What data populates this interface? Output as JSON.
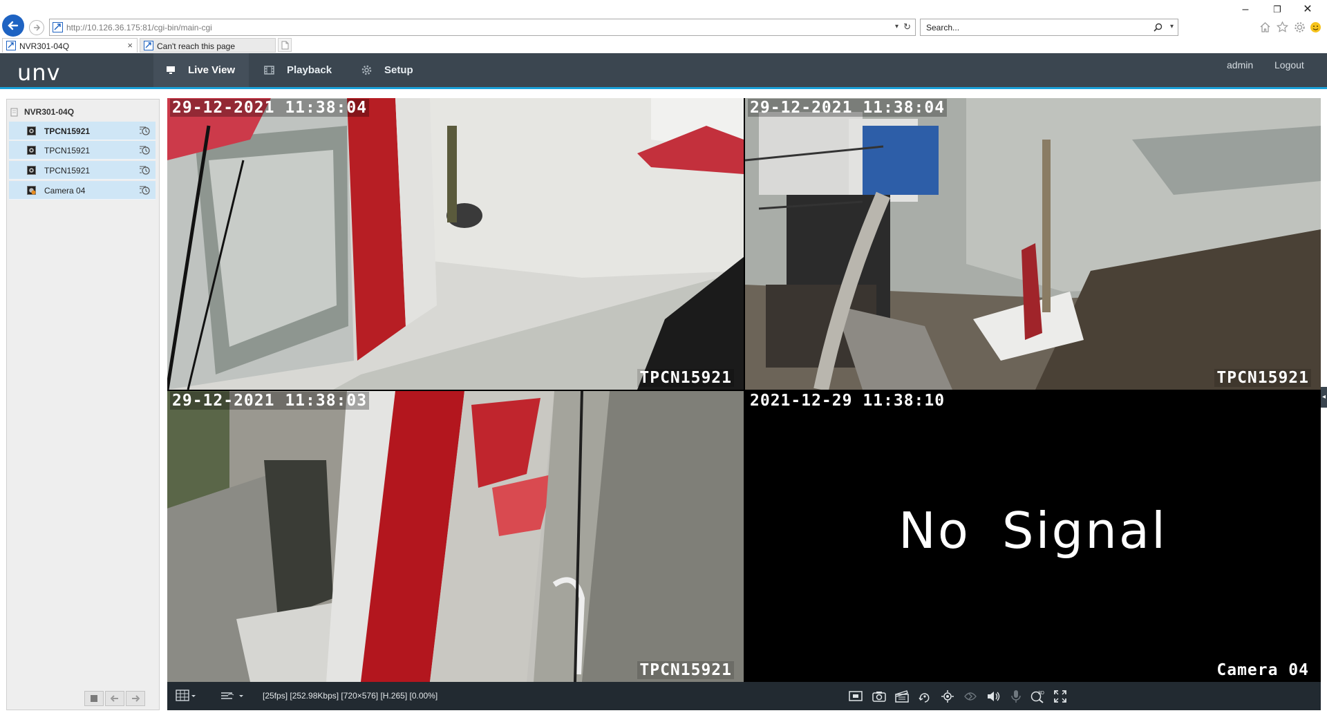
{
  "browser": {
    "url": "http://10.126.36.175:81/cgi-bin/main-cgi",
    "search_placeholder": "Search...",
    "tabs": [
      {
        "label": "NVR301-04Q",
        "active": true
      },
      {
        "label": "Can't reach this page",
        "active": false
      }
    ],
    "window_controls": {
      "minimize": "–",
      "restore": "❐",
      "close": "✕"
    }
  },
  "header": {
    "logo": "unv",
    "nav": [
      {
        "label": "Live View",
        "icon": "monitor-icon",
        "active": true
      },
      {
        "label": "Playback",
        "icon": "film-icon",
        "active": false
      },
      {
        "label": "Setup",
        "icon": "gear-icon",
        "active": false
      }
    ],
    "user": "admin",
    "logout": "Logout"
  },
  "sidebar": {
    "device": "NVR301-04Q",
    "cameras": [
      {
        "label": "TPCN15921",
        "selected": true
      },
      {
        "label": "TPCN15921",
        "selected": false
      },
      {
        "label": "TPCN15921",
        "selected": false
      },
      {
        "label": "Camera 04",
        "selected": false
      }
    ]
  },
  "video": {
    "tiles": [
      {
        "timestamp": "29-12-2021 11:38:04",
        "name": "TPCN15921"
      },
      {
        "timestamp": "29-12-2021 11:38:04",
        "name": "TPCN15921"
      },
      {
        "timestamp": "29-12-2021 11:38:03",
        "name": "TPCN15921"
      },
      {
        "timestamp": "2021-12-29 11:38:10",
        "name": "Camera 04",
        "message": "No Signal"
      }
    ]
  },
  "toolbar": {
    "stream_info": "[25fps] [252.98Kbps] [720×576] [H.265] [0.00%]",
    "icons": [
      "fit-window-icon",
      "snapshot-icon",
      "record-icon",
      "ptz-icon",
      "digital-zoom-icon",
      "fisheye-icon",
      "audio-icon",
      "microphone-icon",
      "zoom-3d-icon",
      "fullscreen-icon"
    ]
  },
  "colors": {
    "header_bg": "#3b4650",
    "accent": "#1aa0d8",
    "selection": "#cfe6f6",
    "toolbar_bg": "#222a31",
    "browser_back": "#1e63c2"
  }
}
